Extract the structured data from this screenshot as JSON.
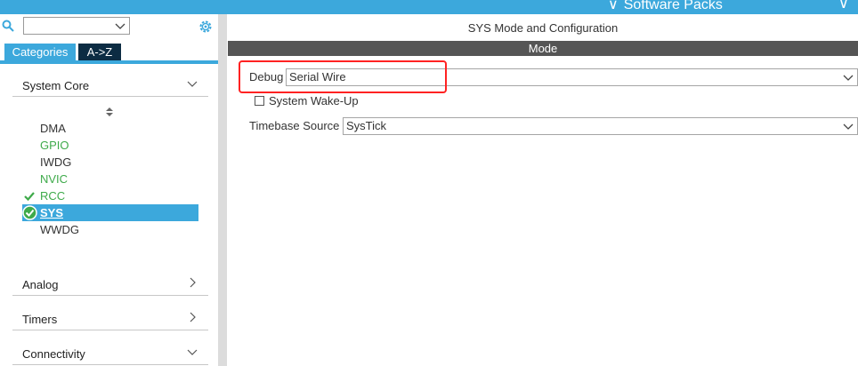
{
  "topbar": {
    "software_packs": "Software Packs"
  },
  "left": {
    "search": {
      "value": ""
    },
    "tabs": {
      "categories": "Categories",
      "az": "A->Z"
    },
    "categories": [
      {
        "label": "System Core",
        "expanded": true
      },
      {
        "label": "Analog",
        "expanded": false
      },
      {
        "label": "Timers",
        "expanded": false
      },
      {
        "label": "Connectivity",
        "expanded": true
      }
    ],
    "system_core_items": [
      {
        "label": "DMA",
        "state": "normal"
      },
      {
        "label": "GPIO",
        "state": "green"
      },
      {
        "label": "IWDG",
        "state": "normal"
      },
      {
        "label": "NVIC",
        "state": "green"
      },
      {
        "label": "RCC",
        "state": "checked"
      },
      {
        "label": "SYS",
        "state": "selected"
      },
      {
        "label": "WWDG",
        "state": "normal"
      }
    ]
  },
  "right": {
    "title": "SYS Mode and Configuration",
    "mode_bar": "Mode",
    "debug": {
      "label": "Debug",
      "value": "Serial Wire"
    },
    "wakeup": {
      "label": "System Wake-Up",
      "checked": false
    },
    "timebase": {
      "label": "Timebase Source",
      "value": "SysTick"
    }
  },
  "colors": {
    "accent": "#3ca8dc",
    "dark_tab": "#0c2c43",
    "green": "#3eaa4a",
    "highlight": "#ff2222"
  }
}
